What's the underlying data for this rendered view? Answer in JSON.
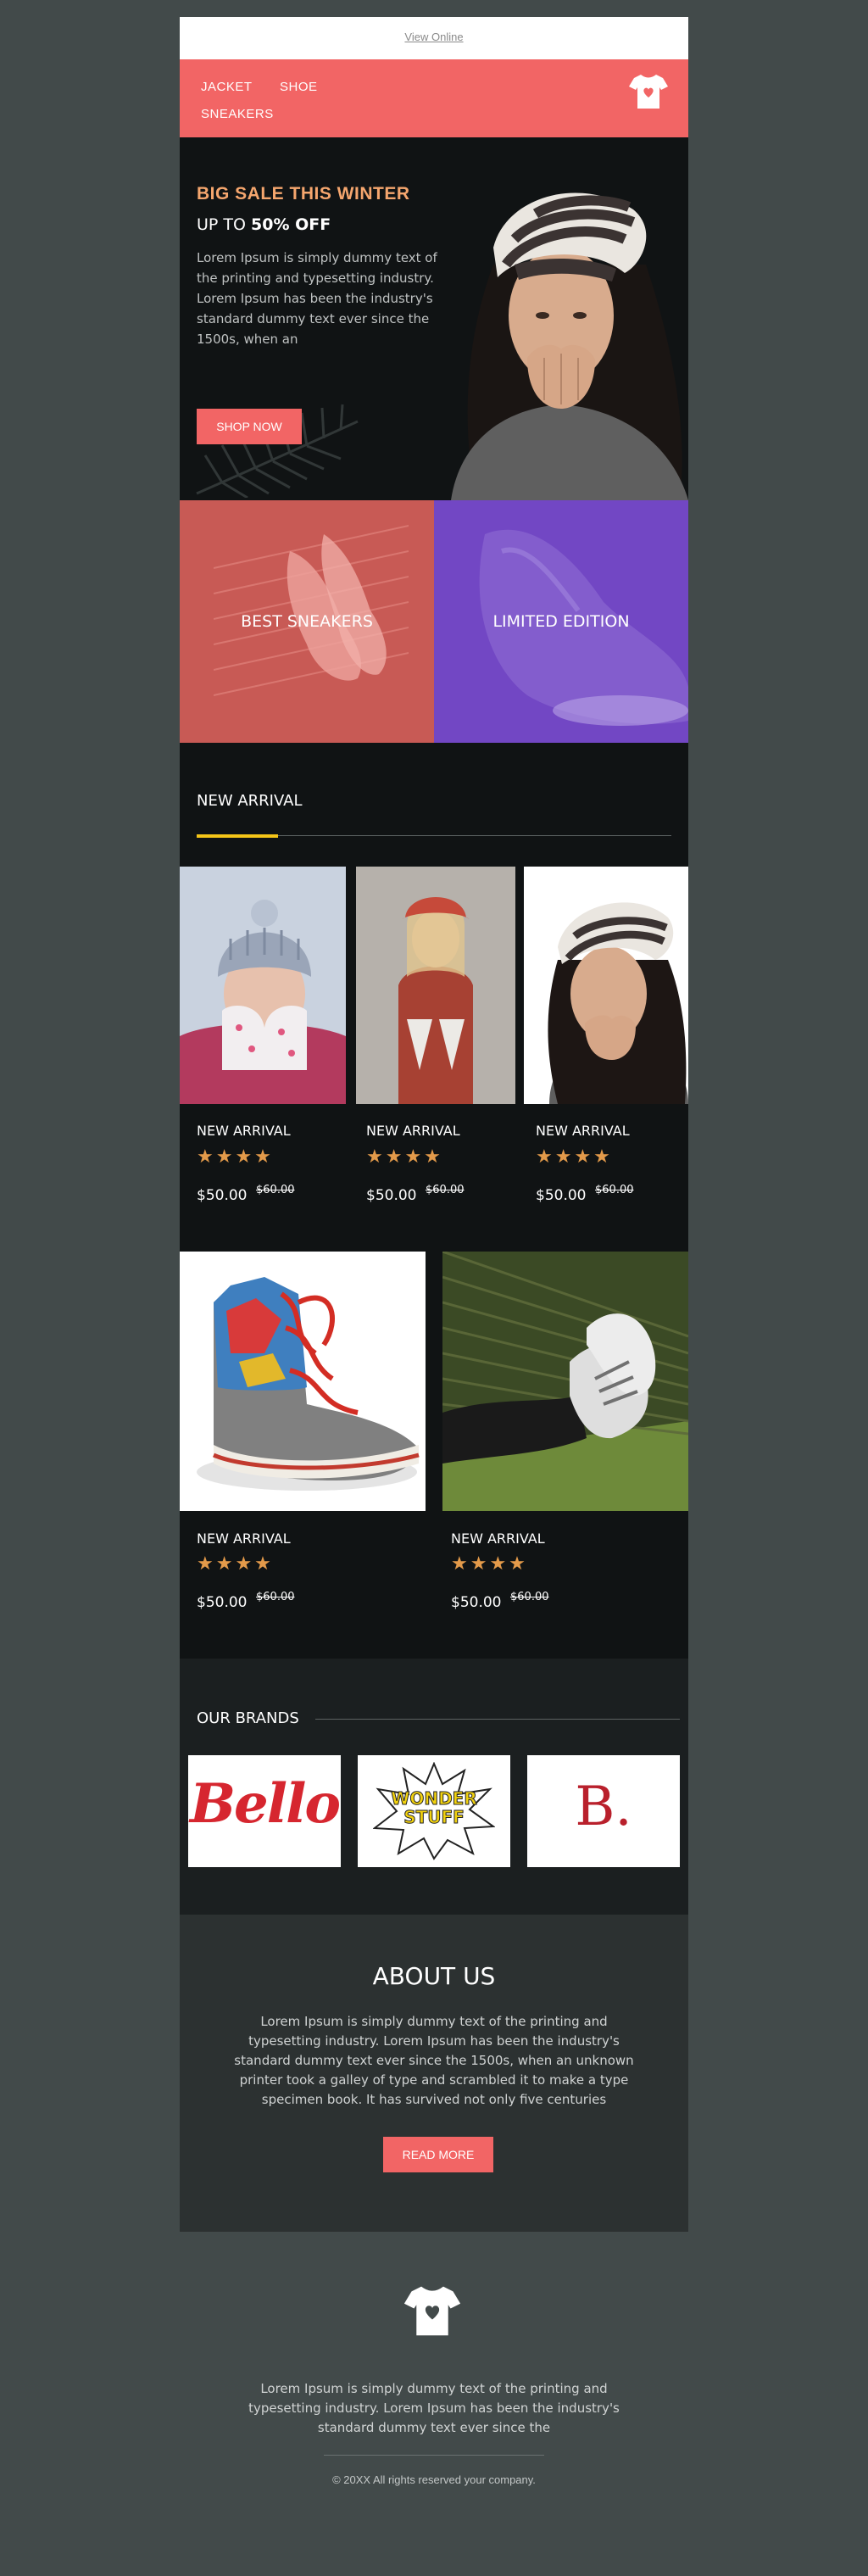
{
  "topbar": {
    "view_online": "View Online"
  },
  "nav": {
    "items": [
      "JACKET",
      "SHOE",
      "SNEAKERS"
    ],
    "logo_icon": "tshirt-heart-icon"
  },
  "hero": {
    "title": "BIG SALE THIS WINTER",
    "subtitle_prefix": "UP TO ",
    "subtitle_bold": "50% OFF",
    "body": "Lorem Ipsum is simply dummy text of the printing and typesetting industry. Lorem Ipsum has been the industry's standard dummy text ever since the 1500s, when an",
    "cta": "SHOP NOW"
  },
  "promos": [
    {
      "label": "BEST SNEAKERS",
      "color": "#c85a55"
    },
    {
      "label": "LIMITED EDITION",
      "color": "#7247c4"
    }
  ],
  "new_arrival": {
    "heading": "NEW ARRIVAL",
    "accent_color": "#f5c518",
    "products_row1": [
      {
        "title": "NEW ARRIVAL",
        "stars": "★★★★",
        "price": "$50.00",
        "old_price": "$60.00"
      },
      {
        "title": "NEW ARRIVAL",
        "stars": "★★★★",
        "price": "$50.00",
        "old_price": "$60.00"
      },
      {
        "title": "NEW ARRIVAL",
        "stars": "★★★★",
        "price": "$50.00",
        "old_price": "$60.00"
      }
    ],
    "products_row2": [
      {
        "title": "NEW ARRIVAL",
        "stars": "★★★★",
        "price": "$50.00",
        "old_price": "$60.00"
      },
      {
        "title": "NEW ARRIVAL",
        "stars": "★★★★",
        "price": "$50.00",
        "old_price": "$60.00"
      }
    ]
  },
  "brands": {
    "heading": "OUR BRANDS",
    "logos": [
      "Bello",
      "WONDER STUFF",
      "B."
    ]
  },
  "about": {
    "heading": "ABOUT US",
    "body": "Lorem Ipsum is simply dummy text of the printing and typesetting industry. Lorem Ipsum has been the industry's standard dummy text ever since the 1500s, when an unknown printer took a galley of type and scrambled it to make a type specimen book. It has survived not only five centuries",
    "cta": "READ MORE"
  },
  "footer": {
    "body": "Lorem Ipsum is simply dummy text of the printing and typesetting industry. Lorem Ipsum has been the industry's standard dummy text ever since the",
    "copyright": "© 20XX All rights reserved your company."
  },
  "colors": {
    "accent": "#f26565",
    "star": "#e39a4a",
    "background": "#424a4a",
    "dark": "#101314"
  }
}
